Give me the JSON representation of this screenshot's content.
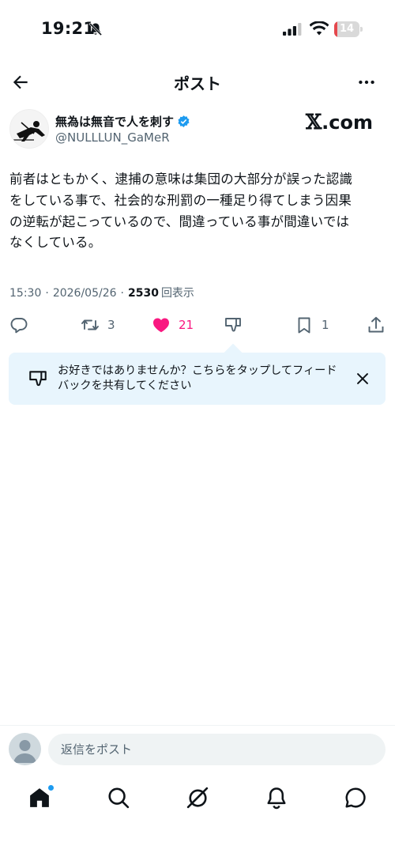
{
  "status_bar": {
    "time": "19:21",
    "battery_level": "14",
    "battery_fraction": 0.14,
    "battery_color": "#e5484d"
  },
  "header": {
    "title": "ポスト",
    "icons": {
      "back": "arrow-left-icon",
      "more": "more-dots-icon"
    }
  },
  "post": {
    "author_name": "無為は無音で人を刺す",
    "author_handle": "@NULLLUN_GaMeR",
    "source_logo_mark": "𝕏",
    "source_logo_domain": ".com",
    "text": "前者はともかく、逮捕の意味は集団の大部分が誤った認識\nをしている事で、社会的な刑罰の一種足り得てしまう因果\nの逆転が起こっているので、間違っている事が間違いでは\nなくしている。",
    "time": "15:30",
    "date": "2026/05/26",
    "views_count": "2530",
    "views_label": "回表示",
    "separator": "·"
  },
  "actions": {
    "reply_count": "",
    "repost_count": "3",
    "like_count": "21",
    "bookmark_count": "1",
    "like_color": "#f91880"
  },
  "feedback": {
    "text": "お好きではありませんか？こちらをタップしてフィード\nバックを共有してください"
  },
  "reply_bar": {
    "placeholder": "返信をポスト"
  },
  "bottom_nav": {
    "items": [
      "home-icon",
      "search-icon",
      "grok-icon",
      "notifications-icon",
      "messages-icon"
    ],
    "accent": "#1d9bf0"
  }
}
